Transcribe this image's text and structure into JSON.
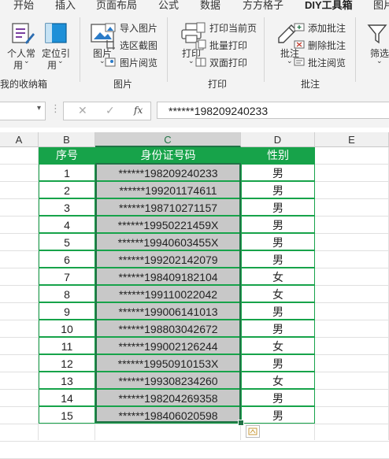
{
  "tabs": [
    "开始",
    "插入",
    "页面布局",
    "公式",
    "数据",
    "方方格子",
    "DIY工具箱",
    "图片"
  ],
  "active_tab": "DIY工具箱",
  "ribbon": {
    "group_partial_label": "我的收纳箱",
    "personal_common": {
      "line1": "个人常",
      "line2": "用"
    },
    "locate_ref": {
      "line1": "定位引",
      "line2": "用"
    },
    "picture_btn": "图片",
    "import_picture": "导入图片",
    "selection_screenshot": "选区截图",
    "picture_browse": "图片阅览",
    "picture_group": "图片",
    "print_btn": "打印",
    "print_current_page": "打印当前页",
    "batch_print": "批量打印",
    "duplex_print": "双面打印",
    "print_group": "打印",
    "comment_btn": "批注",
    "add_comment": "添加批注",
    "delete_comment": "删除批注",
    "comment_browse": "批注阅览",
    "comment_group": "批注",
    "filter_partial": "筛选"
  },
  "formula_bar": {
    "name_box": "",
    "cancel_glyph": "✕",
    "enter_glyph": "✓",
    "fx_label": "fx",
    "formula": "******198209240233"
  },
  "columns": [
    "A",
    "B",
    "C",
    "D",
    "E"
  ],
  "selected_column": "C",
  "header_row": {
    "seq": "序号",
    "id": "身份证号码",
    "gender": "性别"
  },
  "rows": [
    {
      "seq": "1",
      "id": "******198209240233",
      "gender": "男"
    },
    {
      "seq": "2",
      "id": "******199201174611",
      "gender": "男"
    },
    {
      "seq": "3",
      "id": "******198710271157",
      "gender": "男"
    },
    {
      "seq": "4",
      "id": "******19950221459X",
      "gender": "男"
    },
    {
      "seq": "5",
      "id": "******19940603455X",
      "gender": "男"
    },
    {
      "seq": "6",
      "id": "******199202142079",
      "gender": "男"
    },
    {
      "seq": "7",
      "id": "******198409182104",
      "gender": "女"
    },
    {
      "seq": "8",
      "id": "******199110022042",
      "gender": "女"
    },
    {
      "seq": "9",
      "id": "******199006141013",
      "gender": "男"
    },
    {
      "seq": "10",
      "id": "******198803042672",
      "gender": "男"
    },
    {
      "seq": "11",
      "id": "******199002126244",
      "gender": "女"
    },
    {
      "seq": "12",
      "id": "******19950910153X",
      "gender": "男"
    },
    {
      "seq": "13",
      "id": "******199308234260",
      "gender": "女"
    },
    {
      "seq": "14",
      "id": "******198204269358",
      "gender": "男"
    },
    {
      "seq": "15",
      "id": "******198406020598",
      "gender": "男"
    }
  ],
  "colors": {
    "header_fill": "#17a34a",
    "border": "#17a34a",
    "selection": "#c8c8c8",
    "accent": "#217346"
  }
}
